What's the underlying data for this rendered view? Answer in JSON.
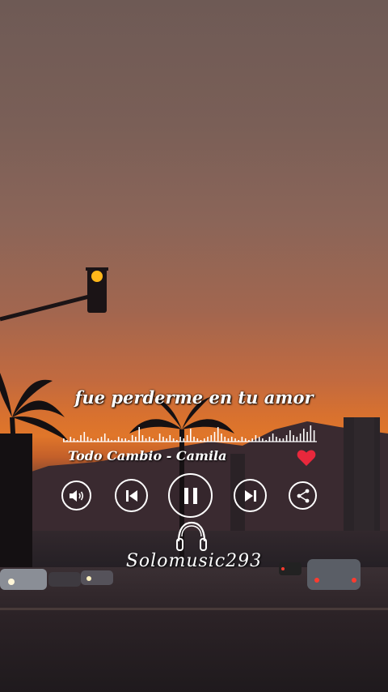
{
  "player": {
    "lyric": "fue perderme en tu amor",
    "song_title": "Todo Cambio - Camila",
    "favorited": true,
    "is_playing": true
  },
  "controls": {
    "volume": "volume-icon",
    "previous": "previous-icon",
    "play_pause": "pause-icon",
    "next": "next-icon",
    "share": "share-icon"
  },
  "watermark": {
    "text": "Solomusic293",
    "icon": "headphones-icon"
  },
  "colors": {
    "accent_heart": "#e8283c",
    "control_stroke": "#ffffff",
    "sunset": "#e0762a"
  }
}
